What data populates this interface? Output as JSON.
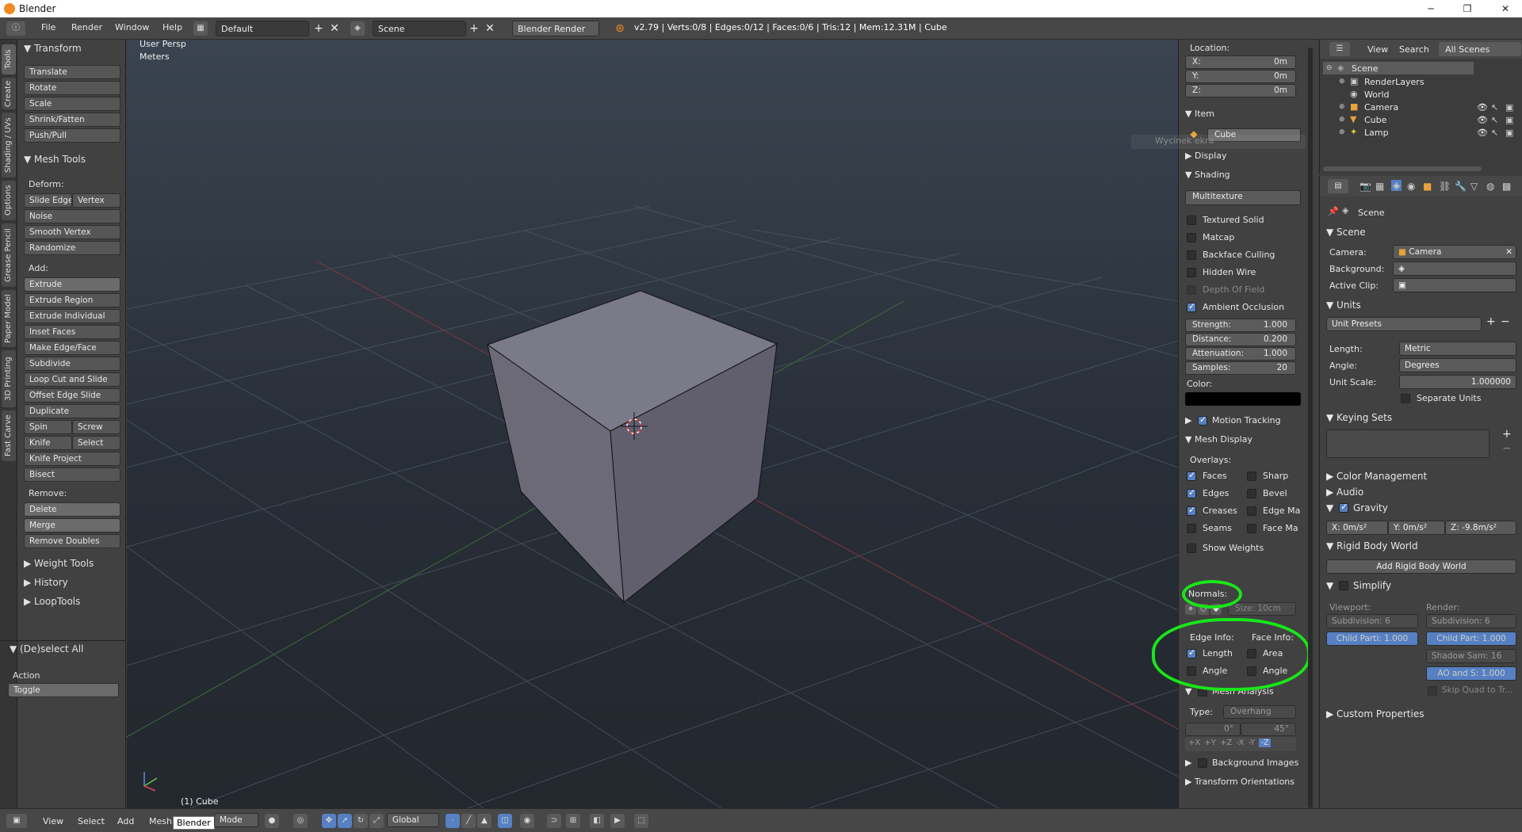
{
  "window": {
    "title": "Blender"
  },
  "header": {
    "menus": [
      "File",
      "Render",
      "Window",
      "Help"
    ],
    "layout": "Default",
    "scene": "Scene",
    "engine": "Blender Render",
    "stats": "v2.79 | Verts:0/8 | Edges:0/12 | Faces:0/6 | Tris:12 | Mem:12.31M | Cube"
  },
  "left_tabs": [
    "Tools",
    "Create",
    "Shading / UVs",
    "Options",
    "Grease Pencil",
    "Paper Model",
    "3D Printing",
    "Fast Carve"
  ],
  "tools": {
    "transform": {
      "title": "Transform",
      "buttons": [
        "Translate",
        "Rotate",
        "Scale",
        "Shrink/Fatten",
        "Push/Pull"
      ]
    },
    "mesh_tools": {
      "title": "Mesh Tools",
      "deform_label": "Deform:",
      "deform": [
        "Slide Edge",
        "Vertex",
        "Noise",
        "Smooth Vertex",
        "Randomize"
      ],
      "add_label": "Add:",
      "add": [
        "Extrude",
        "Extrude Region",
        "Extrude Individual",
        "Inset Faces",
        "Make Edge/Face",
        "Subdivide",
        "Loop Cut and Slide",
        "Offset Edge Slide",
        "Duplicate",
        "Spin",
        "Screw",
        "Knife",
        "Select",
        "Knife Project",
        "Bisect"
      ],
      "remove_label": "Remove:",
      "remove": [
        "Delete",
        "Merge",
        "Remove Doubles"
      ]
    },
    "collapsed": [
      "Weight Tools",
      "History",
      "LoopTools"
    ],
    "operator": {
      "title": "(De)select All",
      "action_label": "Action",
      "action_value": "Toggle"
    }
  },
  "viewport": {
    "view": "User Persp",
    "units": "Meters",
    "object": "(1) Cube"
  },
  "npanel": {
    "location_label": "Location:",
    "location": [
      {
        "axis": "X:",
        "value": "0m"
      },
      {
        "axis": "Y:",
        "value": "0m"
      },
      {
        "axis": "Z:",
        "value": "0m"
      }
    ],
    "item_title": "Item",
    "item_name": "Cube",
    "ghost_text": "Wycinek ekra",
    "display_title": "Display",
    "shading_title": "Shading",
    "shading_mode": "Multitexture",
    "shading_options": [
      {
        "label": "Textured Solid",
        "on": false
      },
      {
        "label": "Matcap",
        "on": false
      },
      {
        "label": "Backface Culling",
        "on": false
      },
      {
        "label": "Hidden Wire",
        "on": false
      },
      {
        "label": "Depth Of Field",
        "on": false
      },
      {
        "label": "Ambient Occlusion",
        "on": true
      }
    ],
    "ao": [
      {
        "label": "Strength:",
        "value": "1.000"
      },
      {
        "label": "Distance:",
        "value": "0.200"
      },
      {
        "label": "Attenuation:",
        "value": "1.000"
      },
      {
        "label": "Samples:",
        "value": "20"
      }
    ],
    "color_label": "Color:",
    "motion_tracking": "Motion Tracking",
    "mesh_display": "Mesh Display",
    "overlays_label": "Overlays:",
    "overlays_left": [
      {
        "label": "Faces",
        "on": true
      },
      {
        "label": "Edges",
        "on": true
      },
      {
        "label": "Creases",
        "on": true
      },
      {
        "label": "Seams",
        "on": false
      }
    ],
    "overlays_right": [
      {
        "label": "Sharp",
        "on": false
      },
      {
        "label": "Bevel",
        "on": false
      },
      {
        "label": "Edge Ma",
        "on": false
      },
      {
        "label": "Face Ma",
        "on": false
      }
    ],
    "show_weights": "Show Weights",
    "normals_label": "Normals:",
    "normals_size": "Size: 10cm",
    "edge_info_label": "Edge Info:",
    "face_info_label": "Face Info:",
    "edge_info": [
      {
        "label": "Length",
        "on": true
      },
      {
        "label": "Angle",
        "on": false
      }
    ],
    "face_info": [
      {
        "label": "Area",
        "on": false
      },
      {
        "label": "Angle",
        "on": false
      }
    ],
    "mesh_analysis": "Mesh Analysis",
    "type_label": "Type:",
    "type_value": "Overhang",
    "range_min": "0°",
    "range_max": "45°",
    "axes": [
      "+X",
      "+Y",
      "+Z",
      "-X",
      "-Y",
      "-Z"
    ],
    "background_images": "Background Images",
    "transform_orientations": "Transform Orientations"
  },
  "outliner": {
    "menus": [
      "View",
      "Search"
    ],
    "filter": "All Scenes",
    "items": [
      "Scene",
      "RenderLayers",
      "World",
      "Camera",
      "Cube",
      "Lamp"
    ]
  },
  "properties": {
    "breadcrumb": "Scene",
    "scene_title": "Scene",
    "camera_label": "Camera:",
    "camera_value": "Camera",
    "background_label": "Background:",
    "active_clip_label": "Active Clip:",
    "units_title": "Units",
    "unit_presets": "Unit Presets",
    "length_label": "Length:",
    "length_value": "Metric",
    "angle_label": "Angle:",
    "angle_value": "Degrees",
    "unit_scale_label": "Unit Scale:",
    "unit_scale_value": "1.000000",
    "separate_units": "Separate Units",
    "keying_sets": "Keying Sets",
    "color_management": "Color Management",
    "audio": "Audio",
    "gravity": "Gravity",
    "gravity_values": [
      {
        "axis": "X:",
        "value": "0m/s²"
      },
      {
        "axis": "Y:",
        "value": "0m/s²"
      },
      {
        "axis": "Z:",
        "value": "-9.8m/s²"
      }
    ],
    "rigid_body_world": "Rigid Body World",
    "add_rigid_body_world": "Add Rigid Body World",
    "simplify": "Simplify",
    "viewport_label": "Viewport:",
    "render_label": "Render:",
    "viewport_fields": [
      "Subdivision: 6",
      "Child Parti: 1.000"
    ],
    "render_fields": [
      "Subdivision: 6",
      "Child Part: 1.000",
      "Shadow Sam: 16",
      "AO and S: 1.000",
      "Skip Quad to Tr..."
    ],
    "custom_properties": "Custom Properties"
  },
  "footer": {
    "menus": [
      "View",
      "Select",
      "Add",
      "Mesh"
    ],
    "tooltip": "Blender",
    "mode": "Mode",
    "orientation": "Global"
  },
  "colors": {
    "accent": "#5680c2",
    "highlight": "#19e619",
    "cube": "#7b7a89"
  }
}
